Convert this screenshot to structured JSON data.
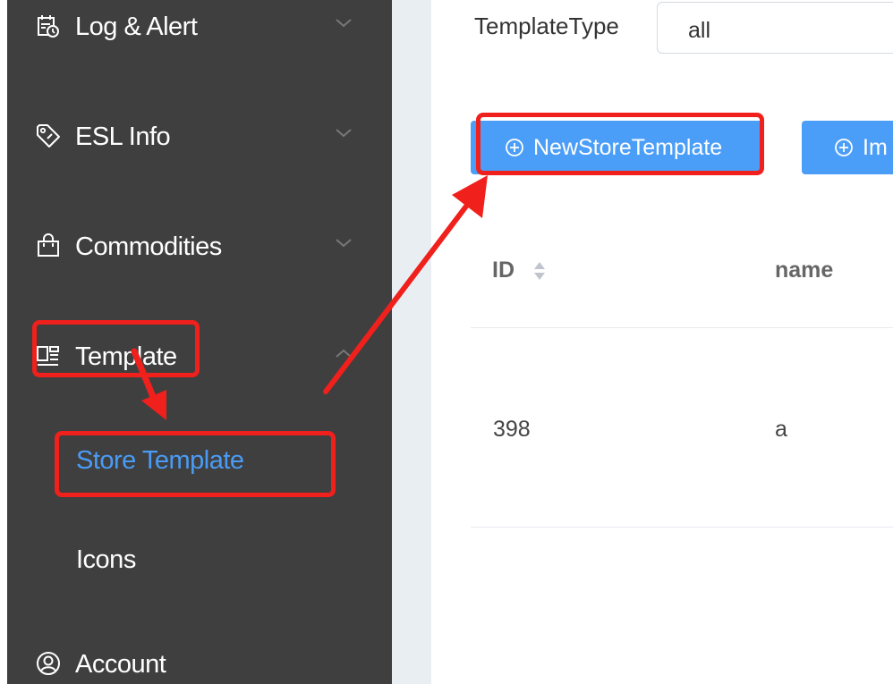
{
  "sidebar": {
    "items": [
      {
        "label": "Log & Alert",
        "icon": "calendar-clock-icon"
      },
      {
        "label": "ESL Info",
        "icon": "price-tag-icon"
      },
      {
        "label": "Commodities",
        "icon": "shopping-bag-icon"
      },
      {
        "label": "Template",
        "icon": "template-layout-icon"
      }
    ],
    "submenu": [
      {
        "label": "Store Template",
        "active": true
      },
      {
        "label": "Icons",
        "active": false
      }
    ],
    "account": {
      "label": "Account",
      "icon": "user-circle-icon"
    }
  },
  "filter": {
    "label": "TemplateType",
    "value": "all"
  },
  "toolbar": {
    "new_label": "NewStoreTemplate",
    "import_label": "Im"
  },
  "table": {
    "columns": [
      "ID",
      "name"
    ],
    "rows": [
      {
        "id": "398",
        "name": "a"
      }
    ]
  },
  "colors": {
    "sidebar_bg": "#3f3f3f",
    "active_text": "#4a9bf5",
    "primary_button": "#4b9ef7",
    "annotation": "#f0201c"
  }
}
